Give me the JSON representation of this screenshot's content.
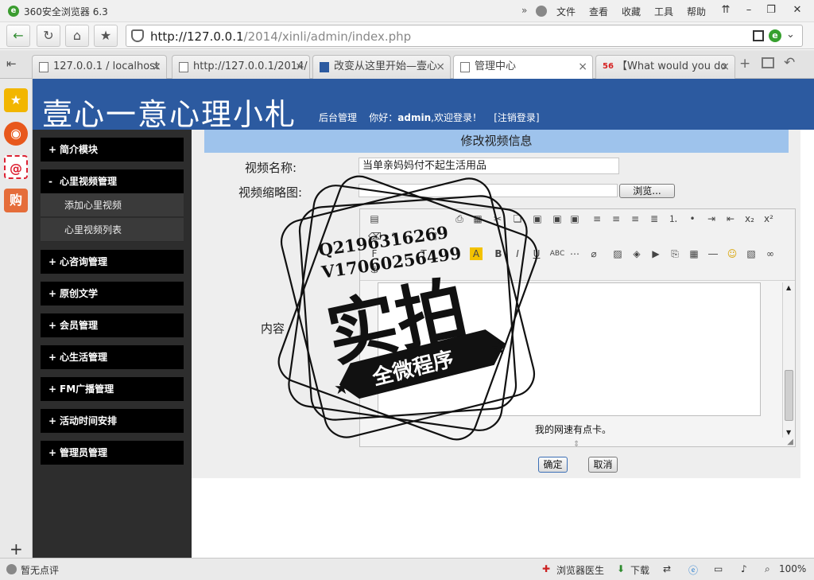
{
  "browser": {
    "title": "360安全浏览器 6.3",
    "menu": [
      "文件",
      "查看",
      "收藏",
      "工具",
      "帮助"
    ],
    "url_host": "http://127.0.0.1",
    "url_path": "/2014/xinli/admin/index.php",
    "tabs": [
      {
        "label": "127.0.0.1 / localhost"
      },
      {
        "label": "http://127.0.0.1/2014/"
      },
      {
        "label": "改变从这里开始—壹心"
      },
      {
        "label": "管理中心"
      },
      {
        "label": "【What would you do"
      }
    ],
    "status_left": "暂无点评",
    "status_doctor": "浏览器医生",
    "status_download": "下载",
    "zoom": "100%"
  },
  "header": {
    "site_title": "壹心一意心理小札",
    "backend": "后台管理",
    "greeting": "你好：",
    "user": "admin",
    "welcome": ",欢迎登录！",
    "logout": "[注销登录]"
  },
  "sidebar": {
    "items": [
      {
        "label": "简介模块",
        "marker": "+"
      },
      {
        "label": "心里视频管理",
        "marker": "-"
      },
      {
        "label": "心咨询管理",
        "marker": "+"
      },
      {
        "label": "原创文学",
        "marker": "+"
      },
      {
        "label": "会员管理",
        "marker": "+"
      },
      {
        "label": "心生活管理",
        "marker": "+"
      },
      {
        "label": "FM广播管理",
        "marker": "+"
      },
      {
        "label": "活动时间安排",
        "marker": "+"
      },
      {
        "label": "管理员管理",
        "marker": "+"
      }
    ],
    "subitems": [
      {
        "label": "添加心里视频"
      },
      {
        "label": "心里视频列表"
      }
    ]
  },
  "form": {
    "heading": "修改视频信息",
    "name_label": "视频名称:",
    "name_value": "当单亲妈妈付不起生活用品",
    "thumb_label": "视频缩略图:",
    "browse_label": "浏览...",
    "content_label": "内容",
    "editor_text": "我的网速有点卡。",
    "confirm_label": "确定",
    "cancel_label": "取消"
  },
  "watermark": {
    "line1": "Q2196316269",
    "line2": "V17060256499",
    "big": "实拍",
    "banner": "全微程序"
  }
}
